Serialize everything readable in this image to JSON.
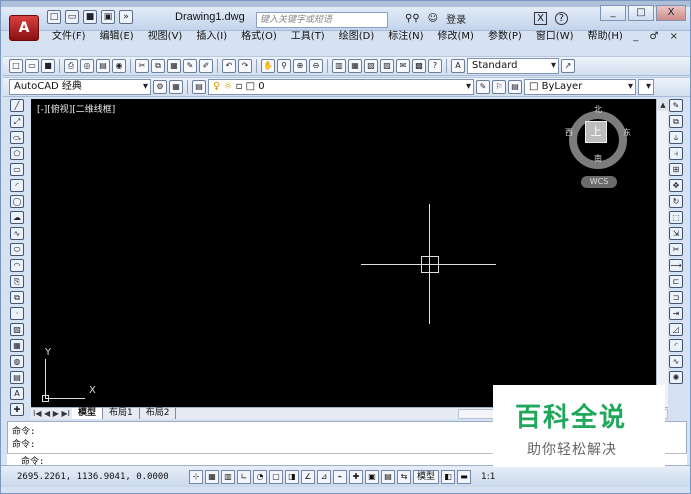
{
  "app": {
    "logo_letter": "A",
    "doc_title": "Drawing1.dwg"
  },
  "titlebar": {
    "search_placeholder": "键入关键字或短语",
    "login_label": "登录",
    "window_buttons": {
      "minimize": "_",
      "restore": "□",
      "close": "X"
    }
  },
  "menu": {
    "items": [
      "文件(F)",
      "编辑(E)",
      "视图(V)",
      "插入(I)",
      "格式(O)",
      "工具(T)",
      "绘图(D)",
      "标注(N)",
      "修改(M)",
      "参数(P)",
      "窗口(W)",
      "帮助(H)"
    ],
    "mdi_controls": "_ ♂ ×"
  },
  "toolbar2": {
    "text_style": "Standard"
  },
  "toolbar3": {
    "workspace": "AutoCAD 经典",
    "layer": "0",
    "color": "ByLayer"
  },
  "viewport": {
    "label": "[-][俯视][二维线框]",
    "viewcube": {
      "face": "上",
      "north": "北",
      "south": "南",
      "east": "东",
      "west": "西",
      "wcs": "WCS"
    },
    "ucs": {
      "x": "X",
      "y": "Y"
    }
  },
  "tabs": {
    "nav": "I◀ ◀ ▶ ▶I",
    "items": [
      "模型",
      "布局1",
      "布局2"
    ],
    "active": "模型"
  },
  "command": {
    "lines": [
      "命令:",
      "命令:"
    ],
    "prompt": "命令:"
  },
  "status": {
    "coords": "2695.2261, 1136.9041, 0.0000",
    "model_label": "模型",
    "scale": "1:1"
  },
  "watermark": {
    "title": "百科全说",
    "subtitle": "助你轻松解决"
  },
  "colors": {
    "canvas": "#000000",
    "crosshair": "#dddddd",
    "brand": "#1fa85a"
  }
}
